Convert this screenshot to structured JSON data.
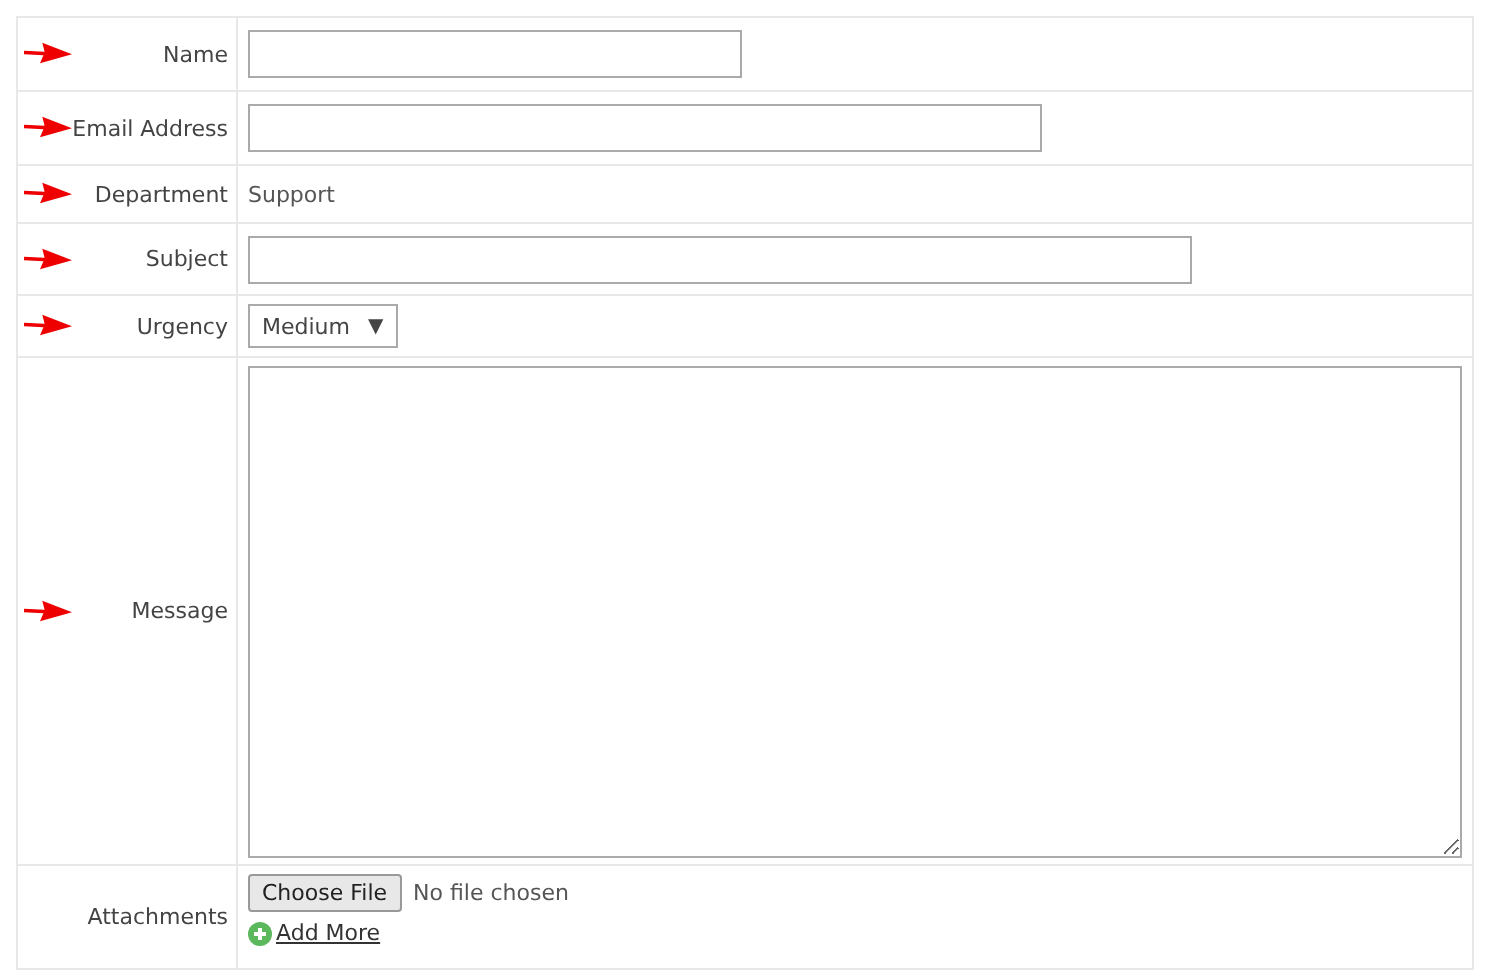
{
  "form": {
    "rows": [
      {
        "kind": "text",
        "label": "Name",
        "marked": true
      },
      {
        "kind": "text",
        "label": "Email Address",
        "marked": true
      },
      {
        "kind": "static",
        "label": "Department",
        "value": "Support",
        "marked": true
      },
      {
        "kind": "text",
        "label": "Subject",
        "marked": true
      },
      {
        "kind": "select",
        "label": "Urgency",
        "value": "Medium",
        "caret": "▼",
        "marked": true
      },
      {
        "kind": "textarea",
        "label": "Message",
        "marked": true
      },
      {
        "kind": "file",
        "label": "Attachments",
        "button": "Choose File",
        "status": "No file chosen",
        "link": "Add More",
        "marked": false
      }
    ]
  }
}
